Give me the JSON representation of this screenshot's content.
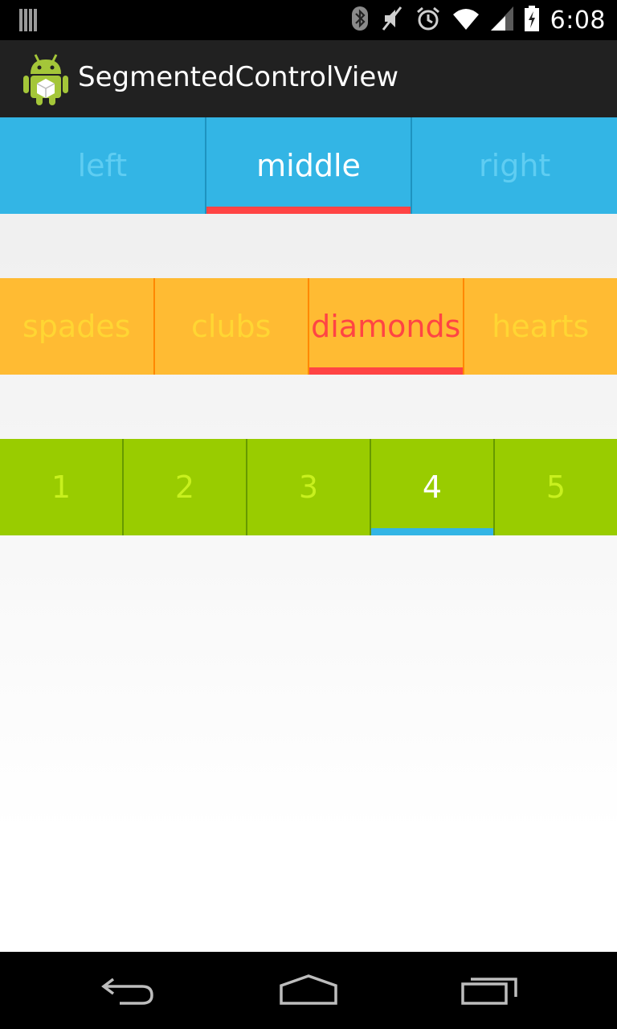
{
  "status_bar": {
    "time": "6:08",
    "icons": [
      "notification-bars-icon",
      "bluetooth-icon",
      "mute-icon",
      "alarm-icon",
      "wifi-icon",
      "signal-icon",
      "battery-icon"
    ]
  },
  "action_bar": {
    "title": "SegmentedControlView",
    "icon": "android-app-icon"
  },
  "segmented_controls": [
    {
      "name": "blue",
      "background": "#33b5e5",
      "indicator_color": "#ff4444",
      "selected_index": 1,
      "segments": [
        "left",
        "middle",
        "right"
      ]
    },
    {
      "name": "orange",
      "background": "#ffbb33",
      "indicator_color": "#ff4444",
      "selected_index": 2,
      "segments": [
        "spades",
        "clubs",
        "diamonds",
        "hearts"
      ]
    },
    {
      "name": "green",
      "background": "#99cc00",
      "indicator_color": "#33b5e5",
      "selected_index": 3,
      "segments": [
        "1",
        "2",
        "3",
        "4",
        "5"
      ]
    }
  ],
  "nav_bar": {
    "buttons": [
      "back-icon",
      "home-icon",
      "recent-apps-icon"
    ]
  }
}
